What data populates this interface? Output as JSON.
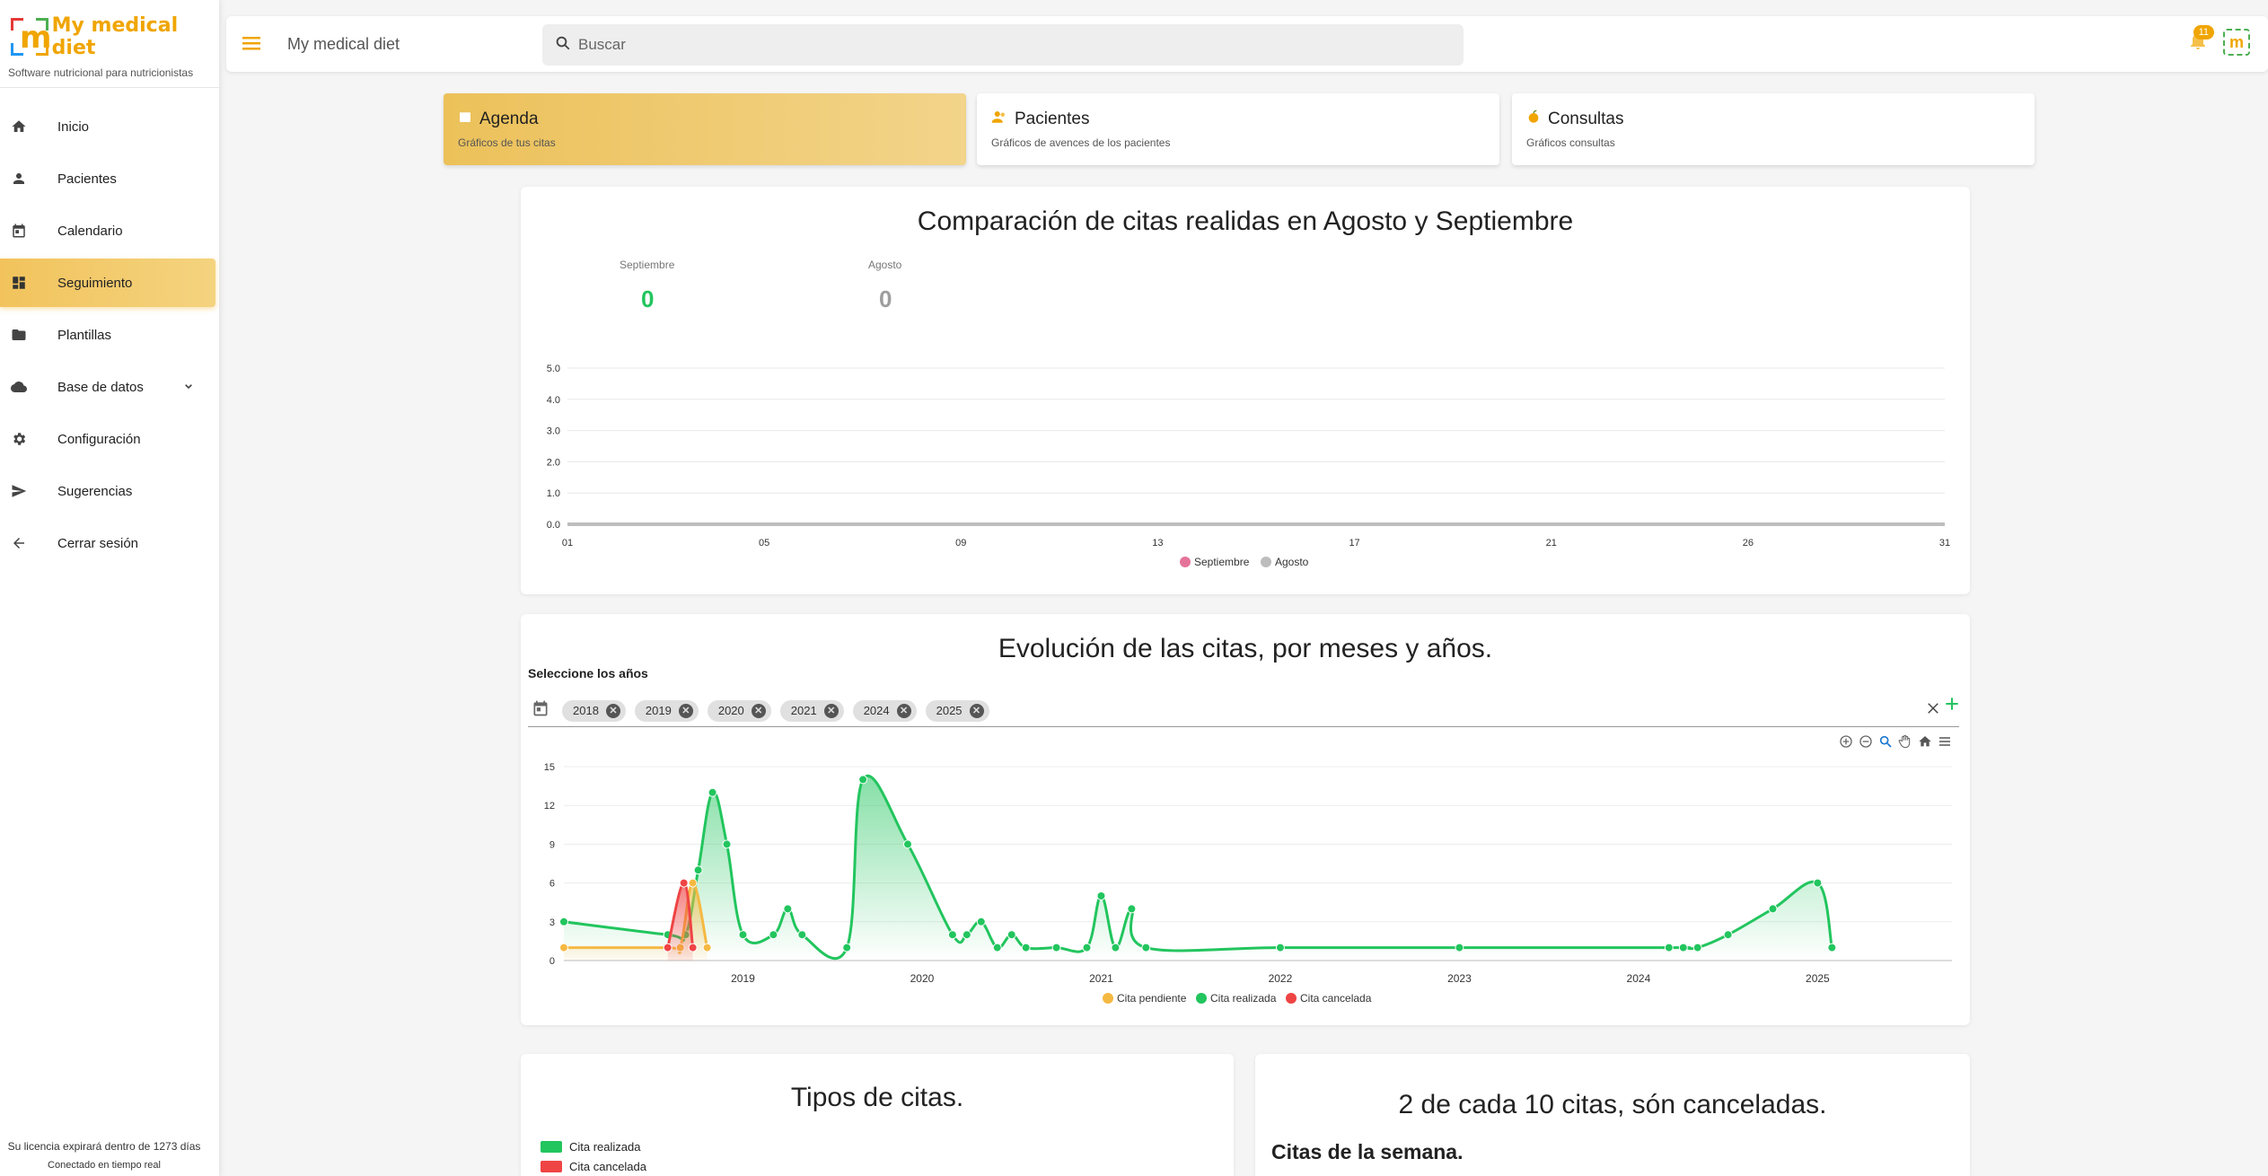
{
  "brand": {
    "name": "My medical diet",
    "subtitle": "Software nutricional para nutricionistas"
  },
  "topbar": {
    "title": "My medical diet",
    "search_placeholder": "Buscar",
    "notifications": "11"
  },
  "sidebar": {
    "items": [
      {
        "label": "Inicio",
        "icon": "home-icon"
      },
      {
        "label": "Pacientes",
        "icon": "person-icon"
      },
      {
        "label": "Calendario",
        "icon": "calendar-icon"
      },
      {
        "label": "Seguimiento",
        "icon": "dashboard-icon",
        "active": true
      },
      {
        "label": "Plantillas",
        "icon": "folder-icon"
      },
      {
        "label": "Base de datos",
        "icon": "cloud-icon"
      },
      {
        "label": "Configuración",
        "icon": "gear-icon"
      },
      {
        "label": "Sugerencias",
        "icon": "send-icon"
      },
      {
        "label": "Cerrar sesión",
        "icon": "arrow-left-icon"
      }
    ],
    "license": "Su licencia expirará dentro de 1273 días",
    "connection": "Conectado en tiempo real"
  },
  "tabs": [
    {
      "title": "Agenda",
      "subtitle": "Gráficos de tus citas"
    },
    {
      "title": "Pacientes",
      "subtitle": "Gráficos de avences de los pacientes"
    },
    {
      "title": "Consultas",
      "subtitle": "Gráficos consultas"
    }
  ],
  "comparison": {
    "title": "Comparación de citas realidas en Agosto y Septiembre",
    "stats": [
      {
        "label": "Septiembre",
        "value": "0"
      },
      {
        "label": "Agosto",
        "value": "0"
      }
    ]
  },
  "evolution": {
    "title": "Evolución de las citas, por meses y años.",
    "select_label": "Seleccione los años",
    "years": [
      "2018",
      "2019",
      "2020",
      "2021",
      "2024",
      "2025"
    ]
  },
  "types": {
    "title": "Tipos de citas.",
    "legend": [
      "Cita realizada",
      "Cita cancelada"
    ]
  },
  "cancel": {
    "title": "2 de cada 10 citas, són canceladas.",
    "week_label": "Citas de la semana."
  },
  "colors": {
    "accent": "#f0a500",
    "green": "#22c55e",
    "red": "#ef4444",
    "pending": "#f5b942",
    "pink": "#e57399",
    "grey": "#bdbdbd"
  },
  "chart_data": [
    {
      "type": "line",
      "title": "Comparación de citas realidas en Agosto y Septiembre",
      "x": [
        "01",
        "05",
        "09",
        "13",
        "17",
        "21",
        "26",
        "31"
      ],
      "y_ticks": [
        "0.0",
        "1.0",
        "2.0",
        "3.0",
        "4.0",
        "5.0"
      ],
      "ylim": [
        0,
        5
      ],
      "series": [
        {
          "name": "Septiembre",
          "values": [
            0,
            0,
            0,
            0,
            0,
            0,
            0,
            0
          ]
        },
        {
          "name": "Agosto",
          "values": [
            0,
            0,
            0,
            0,
            0,
            0,
            0,
            0
          ]
        }
      ],
      "legend": "bottom"
    },
    {
      "type": "area",
      "title": "Evolución de las citas, por meses y años.",
      "x_ticks": [
        "2019",
        "2020",
        "2021",
        "2022",
        "2023",
        "2024",
        "2025"
      ],
      "y_ticks": [
        "0",
        "3",
        "6",
        "9",
        "12",
        "15"
      ],
      "ylim": [
        0,
        15
      ],
      "legend": "bottom",
      "series": [
        {
          "name": "Cita pendiente",
          "points": [
            [
              2018.0,
              1
            ],
            [
              2018.58,
              1
            ],
            [
              2018.65,
              1
            ],
            [
              2018.72,
              6
            ],
            [
              2018.8,
              1
            ]
          ]
        },
        {
          "name": "Cita realizada",
          "points": [
            [
              2018.0,
              3
            ],
            [
              2018.58,
              2
            ],
            [
              2018.68,
              2
            ],
            [
              2018.75,
              7
            ],
            [
              2018.83,
              13
            ],
            [
              2018.91,
              9
            ],
            [
              2019.0,
              2
            ],
            [
              2019.17,
              2
            ],
            [
              2019.25,
              4
            ],
            [
              2019.33,
              2
            ],
            [
              2019.58,
              1
            ],
            [
              2019.67,
              14
            ],
            [
              2019.92,
              9
            ],
            [
              2020.17,
              2
            ],
            [
              2020.25,
              2
            ],
            [
              2020.33,
              3
            ],
            [
              2020.42,
              1
            ],
            [
              2020.5,
              2
            ],
            [
              2020.58,
              1
            ],
            [
              2020.75,
              1
            ],
            [
              2020.92,
              1
            ],
            [
              2021.0,
              5
            ],
            [
              2021.08,
              1
            ],
            [
              2021.17,
              4
            ],
            [
              2021.25,
              1
            ],
            [
              2022.0,
              1
            ],
            [
              2023.0,
              1
            ],
            [
              2024.17,
              1
            ],
            [
              2024.25,
              1
            ],
            [
              2024.33,
              1
            ],
            [
              2024.5,
              2
            ],
            [
              2024.75,
              4
            ],
            [
              2025.0,
              6
            ],
            [
              2025.08,
              1
            ]
          ]
        },
        {
          "name": "Cita cancelada",
          "points": [
            [
              2018.58,
              1
            ],
            [
              2018.67,
              6
            ],
            [
              2018.72,
              1
            ]
          ]
        }
      ]
    }
  ]
}
